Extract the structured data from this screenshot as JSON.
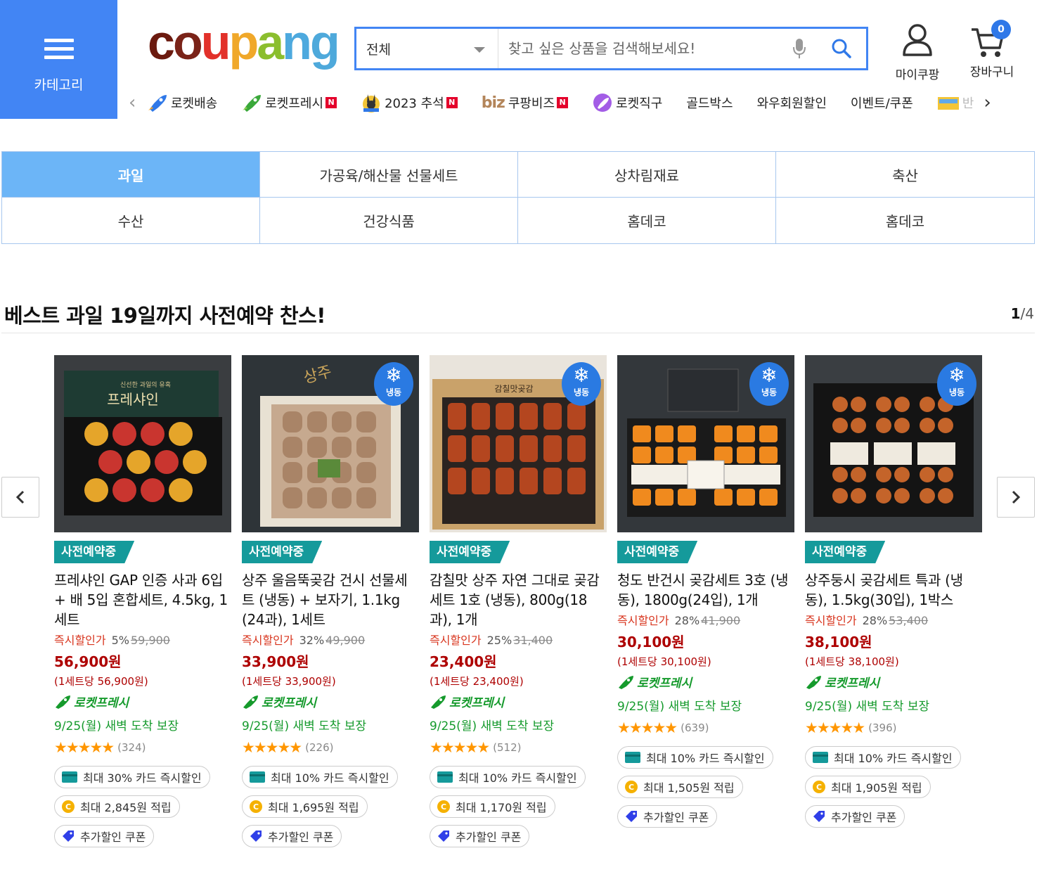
{
  "header": {
    "category_label": "카테고리",
    "logo_letters": [
      "c",
      "o",
      "u",
      "p",
      "a",
      "n",
      "g"
    ],
    "search_scope": "전체",
    "search_placeholder": "찾고 싶은 상품을 검색해보세요!",
    "my_coupang_label": "마이쿠팡",
    "cart_label": "장바구니",
    "cart_count": "0"
  },
  "subnav": {
    "items": [
      {
        "label": "로켓배송",
        "icon": "rocket-blue-icon",
        "new": false
      },
      {
        "label": "로켓프레시",
        "icon": "rocket-green-icon",
        "new": true
      },
      {
        "label": "2023 추석",
        "icon": "chuseok-rabbit-icon",
        "new": true
      },
      {
        "label": "쿠팡비즈",
        "prefix": "biz",
        "new": true
      },
      {
        "label": "로켓직구",
        "icon": "rocket-purple-icon",
        "new": false
      },
      {
        "label": "골드박스"
      },
      {
        "label": "와우회원할인"
      },
      {
        "label": "이벤트/쿠폰"
      },
      {
        "label": "반"
      }
    ],
    "new_badge": "N"
  },
  "categories": [
    {
      "label": "과일",
      "active": true
    },
    {
      "label": "가공육/해산물 선물세트"
    },
    {
      "label": "상차림재료"
    },
    {
      "label": "축산"
    },
    {
      "label": "수산"
    },
    {
      "label": "건강식품"
    },
    {
      "label": "홈데코"
    },
    {
      "label": "홈데코"
    }
  ],
  "section": {
    "title": "베스트 과일 19일까지 사전예약 찬스!",
    "page_current": "1",
    "page_total": "/4"
  },
  "products": [
    {
      "presale": "사전예약중",
      "name": "프레샤인 GAP 인증 사과 6입 + 배 5입 혼합세트, 4.5kg, 1세트",
      "disc_label": "즉시할인가",
      "pct": "5%",
      "orig": "59,900",
      "price": "56,900원",
      "unit": "(1세트당 56,900원)",
      "rocket": "로켓프레시",
      "arrive": "9/25(월) 새벽 도착 보장",
      "rating": 4.5,
      "reviews": "(324)",
      "card": "최대 30% 카드 즉시할인",
      "points": "최대 2,845원 적립",
      "coupon": "추가할인 쿠폰",
      "frozen": false
    },
    {
      "presale": "사전예약중",
      "name": "상주 울음뚝곶감 건시 선물세트 (냉동) + 보자기, 1.1kg (24과), 1세트",
      "disc_label": "즉시할인가",
      "pct": "32%",
      "orig": "49,900",
      "price": "33,900원",
      "unit": "(1세트당 33,900원)",
      "rocket": "로켓프레시",
      "arrive": "9/25(월) 새벽 도착 보장",
      "rating": 4.5,
      "reviews": "(226)",
      "card": "최대 10% 카드 즉시할인",
      "points": "최대 1,695원 적립",
      "coupon": "추가할인 쿠폰",
      "frozen": true
    },
    {
      "presale": "사전예약중",
      "name": "감칠맛 상주 자연 그대로 곶감 세트 1호 (냉동), 800g(18과), 1개",
      "disc_label": "즉시할인가",
      "pct": "25%",
      "orig": "31,400",
      "price": "23,400원",
      "unit": "(1세트당 23,400원)",
      "rocket": "로켓프레시",
      "arrive": "9/25(월) 새벽 도착 보장",
      "rating": 4.5,
      "reviews": "(512)",
      "card": "최대 10% 카드 즉시할인",
      "points": "최대 1,170원 적립",
      "coupon": "추가할인 쿠폰",
      "frozen": true
    },
    {
      "presale": "사전예약중",
      "name": "청도 반건시 곶감세트 3호 (냉동), 1800g(24입), 1개",
      "disc_label": "즉시할인가",
      "pct": "28%",
      "orig": "41,900",
      "price": "30,100원",
      "unit": "(1세트당 30,100원)",
      "rocket": "로켓프레시",
      "arrive": "9/25(월) 새벽 도착 보장",
      "rating": 4.5,
      "reviews": "(639)",
      "card": "최대 10% 카드 즉시할인",
      "points": "최대 1,505원 적립",
      "coupon": "추가할인 쿠폰",
      "frozen": true
    },
    {
      "presale": "사전예약중",
      "name": "상주둥시 곶감세트 특과 (냉동), 1.5kg(30입), 1박스",
      "disc_label": "즉시할인가",
      "pct": "28%",
      "orig": "53,400",
      "price": "38,100원",
      "unit": "(1세트당 38,100원)",
      "rocket": "로켓프레시",
      "arrive": "9/25(월) 새벽 도착 보장",
      "rating": 4.5,
      "reviews": "(396)",
      "card": "최대 10% 카드 즉시할인",
      "points": "최대 1,905원 적립",
      "coupon": "추가할인 쿠폰",
      "frozen": true
    }
  ],
  "frozen_label": "냉동",
  "colors": {
    "accent_blue": "#4285f4",
    "presale_teal": "#159a9b",
    "price_red": "#ae0000",
    "rocket_green": "#159a2c",
    "star_orange": "#ff9600"
  }
}
